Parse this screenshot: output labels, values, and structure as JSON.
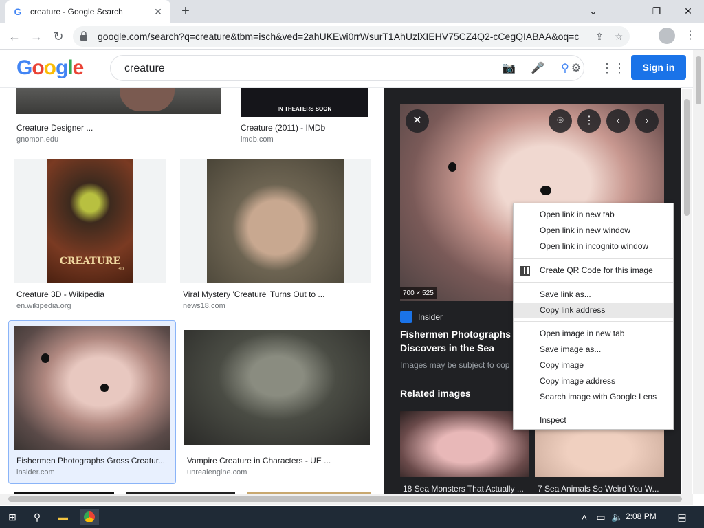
{
  "browser": {
    "tab_title": "creature - Google Search",
    "url": "google.com/search?q=creature&tbm=isch&ved=2ahUKEwi0rrWsurT1AhUzlXIEHV75CZ4Q2-cCegQIABAA&oq=creatu..."
  },
  "google": {
    "logo": "Google",
    "query": "creature",
    "signin_label": "Sign in"
  },
  "results": [
    {
      "caption": "Creature Designer ...",
      "domain": "gnomon.edu"
    },
    {
      "caption": "Creature (2011) - IMDb",
      "domain": "imdb.com",
      "poster_text": "IN THEATERS SOON"
    },
    {
      "caption": "Creature 3D - Wikipedia",
      "domain": "en.wikipedia.org",
      "poster_title": "CREATURE",
      "poster_sub": "3D"
    },
    {
      "caption": "Viral Mystery 'Creature' Turns Out to ...",
      "domain": "news18.com"
    },
    {
      "caption": "Fishermen Photographs Gross Creatur...",
      "domain": "insider.com"
    },
    {
      "caption": "Vampire Creature in Characters - UE ...",
      "domain": "unrealengine.com"
    }
  ],
  "panel": {
    "dimensions": "700 × 525",
    "source": "Insider",
    "title": "Fishermen Photographs He Discovers in the Sea",
    "note": "Images may be subject to cop",
    "related_label": "Related images",
    "related": [
      {
        "caption": "18 Sea Monsters That Actually ..."
      },
      {
        "caption": "7 Sea Animals So Weird You W..."
      }
    ]
  },
  "context_menu": {
    "items": [
      "Open link in new tab",
      "Open link in new window",
      "Open link in incognito window",
      "Create QR Code for this image",
      "Save link as...",
      "Copy link address",
      "Open image in new tab",
      "Save image as...",
      "Copy image",
      "Copy image address",
      "Search image with Google Lens",
      "Inspect"
    ],
    "highlighted": "Copy link address"
  },
  "taskbar": {
    "time": "2:08 PM"
  },
  "colors": {
    "accent": "#1a73e8",
    "panel_bg": "#202124"
  }
}
